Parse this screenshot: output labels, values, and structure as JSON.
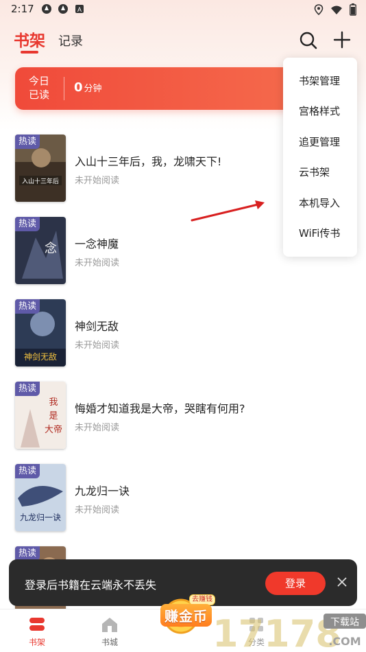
{
  "status_bar": {
    "time": "2:17"
  },
  "header": {
    "tab_shelf": "书架",
    "tab_record": "记录"
  },
  "banner": {
    "label": "今日已读",
    "value": "0",
    "unit": "分钟"
  },
  "menu": {
    "items": [
      "书架管理",
      "宫格样式",
      "追更管理",
      "云书架",
      "本机导入",
      "WiFi传书"
    ]
  },
  "books": [
    {
      "badge": "热读",
      "title": "入山十三年后，我，龙啸天下!",
      "status": "未开始阅读",
      "cover_color": "#6b5a45"
    },
    {
      "badge": "热读",
      "title": "一念神魔",
      "status": "未开始阅读",
      "cover_color": "#2c3348"
    },
    {
      "badge": "热读",
      "title": "神剑无敌",
      "status": "未开始阅读",
      "cover_color": "#2d3b55"
    },
    {
      "badge": "热读",
      "title": "悔婚才知道我是大帝，哭瞎有何用?",
      "status": "未开始阅读",
      "cover_color": "#f3ece6"
    },
    {
      "badge": "热读",
      "title": "九龙归一诀",
      "status": "未开始阅读",
      "cover_color": "#c9d6e6"
    },
    {
      "badge": "热读",
      "title": "",
      "status": "",
      "cover_color": "#8a6a50"
    }
  ],
  "toast": {
    "text": "登录后书籍在云端永不丢失",
    "login_label": "登录"
  },
  "bottom_nav": {
    "shelf_label": "书架",
    "store_label": "书城",
    "coin_label": "赚金币",
    "coin_small": "去赚钱",
    "category_label": "分类"
  },
  "watermark": {
    "text": "17178",
    "sub": "下载站",
    "domain": ".COM"
  },
  "colors": {
    "accent": "#e8382f",
    "badge": "#5f5aa8",
    "toast_bg": "#2b2b2b"
  }
}
